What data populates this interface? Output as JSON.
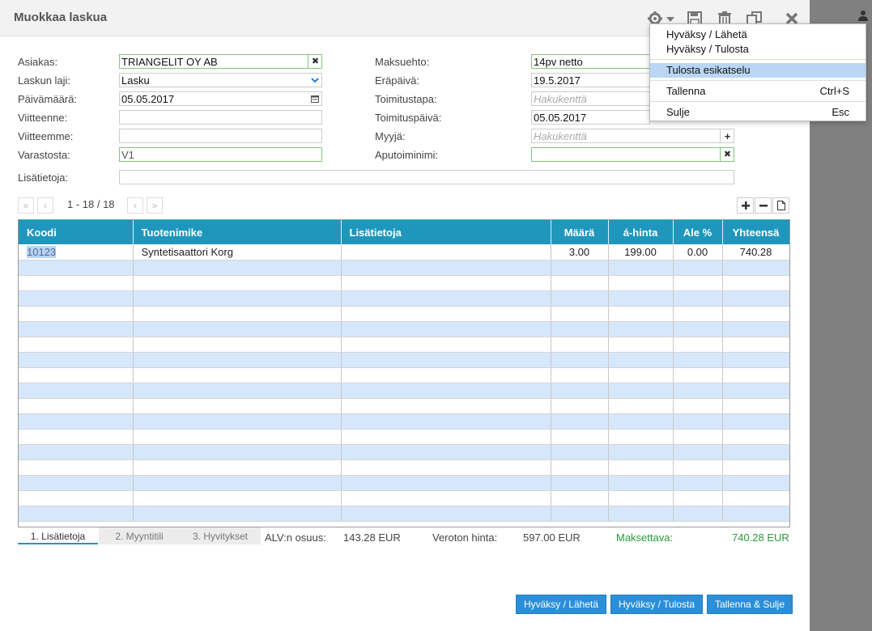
{
  "dialog": {
    "title": "Muokkaa laskua"
  },
  "colors": {
    "accent": "#1f97bd",
    "row_alt": "#d6e7fb",
    "button": "#2b8fd8",
    "total_green": "#2a9a3a"
  },
  "form": {
    "asiakas": {
      "label": "Asiakas:",
      "value": "TRIANGELIT OY AB"
    },
    "laskun_laji": {
      "label": "Laskun laji:",
      "value": "Lasku"
    },
    "paivamaara": {
      "label": "Päivämäärä:",
      "value": "05.05.2017"
    },
    "viitteenne": {
      "label": "Viitteenne:",
      "value": ""
    },
    "viitteemme": {
      "label": "Viitteemme:",
      "value": ""
    },
    "varastosta": {
      "label": "Varastosta:",
      "value": "V1"
    },
    "maksuehto": {
      "label": "Maksuehto:",
      "value": "14pv netto"
    },
    "erapaiva": {
      "label": "Eräpäivä:",
      "value": "19.5.2017"
    },
    "toimitustapa": {
      "label": "Toimitustapa:",
      "placeholder": "Hakukenttä"
    },
    "toimituspaiva": {
      "label": "Toimituspäivä:",
      "value": "05.05.2017"
    },
    "myyja": {
      "label": "Myyjä:",
      "placeholder": "Hakukenttä"
    },
    "aputoiminimi": {
      "label": "Aputoiminimi:",
      "value": ""
    },
    "lisatietoja": {
      "label": "Lisätietoja:",
      "value": ""
    }
  },
  "pager": {
    "first": "«",
    "prev": "‹",
    "next": "›",
    "last": "»",
    "text": "1 - 18 / 18"
  },
  "grid": {
    "columns": [
      "Koodi",
      "Tuotenimike",
      "Lisätietoja",
      "Määrä",
      "á-hinta",
      "Ale %",
      "Yhteensä"
    ],
    "rows": [
      {
        "koodi": "10123",
        "nimike": "Syntetisaattori Korg",
        "lisatietoja": "",
        "maara": "3.00",
        "hinta": "199.00",
        "ale": "0.00",
        "yhteensa": "740.28"
      }
    ]
  },
  "tabs": [
    "1. Lisätietoja",
    "2. Myyntitili",
    "3. Hyvitykset"
  ],
  "summary": {
    "alv_label": "ALV:n osuus:",
    "alv_value": "143.28 EUR",
    "veroton_label": "Veroton hinta:",
    "veroton_value": "597.00 EUR",
    "maksettava_label": "Maksettava:",
    "maksettava_value": "740.28 EUR"
  },
  "buttons": {
    "hyvaksy_laheta": "Hyväksy / Lähetä",
    "hyvaksy_tulosta": "Hyväksy / Tulosta",
    "tallenna_sulje": "Tallenna & Sulje"
  },
  "menu": {
    "items": [
      {
        "label": "Hyväksy / Lähetä",
        "shortcut": ""
      },
      {
        "label": "Hyväksy / Tulosta",
        "shortcut": ""
      },
      {
        "label": "Tulosta esikatselu",
        "shortcut": ""
      },
      {
        "label": "Tallenna",
        "shortcut": "Ctrl+S"
      },
      {
        "label": "Sulje",
        "shortcut": "Esc"
      }
    ]
  }
}
